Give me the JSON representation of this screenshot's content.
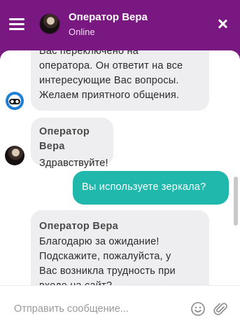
{
  "header": {
    "operator_name": "Оператор Вера",
    "status": "Online",
    "menu_icon": "hamburger-menu-icon",
    "close_icon": "close-icon"
  },
  "messages": [
    {
      "from": "bot",
      "lines": [
        "Вас переключено на",
        "оператора. Он ответит на все",
        "интересующие Вас вопросы.",
        "Желаем приятного общения."
      ]
    },
    {
      "from": "operator",
      "sender": "Оператор Вера",
      "lines": [
        "Здравствуйте!"
      ]
    },
    {
      "from": "user",
      "lines": [
        "Вы используете зеркала?"
      ]
    },
    {
      "from": "operator",
      "sender": "Оператор Вера",
      "lines": [
        "Благодарю за ожидание!",
        "Подскажите, пожалуйста, у",
        "Вас возникла трудность при",
        "входе на сайт?"
      ]
    }
  ],
  "input": {
    "placeholder": "Отправить сообщение...",
    "value": ""
  },
  "colors": {
    "header_bg": "#7a1882",
    "user_bubble": "#20b8ad",
    "agent_bubble": "#eeeef0"
  }
}
